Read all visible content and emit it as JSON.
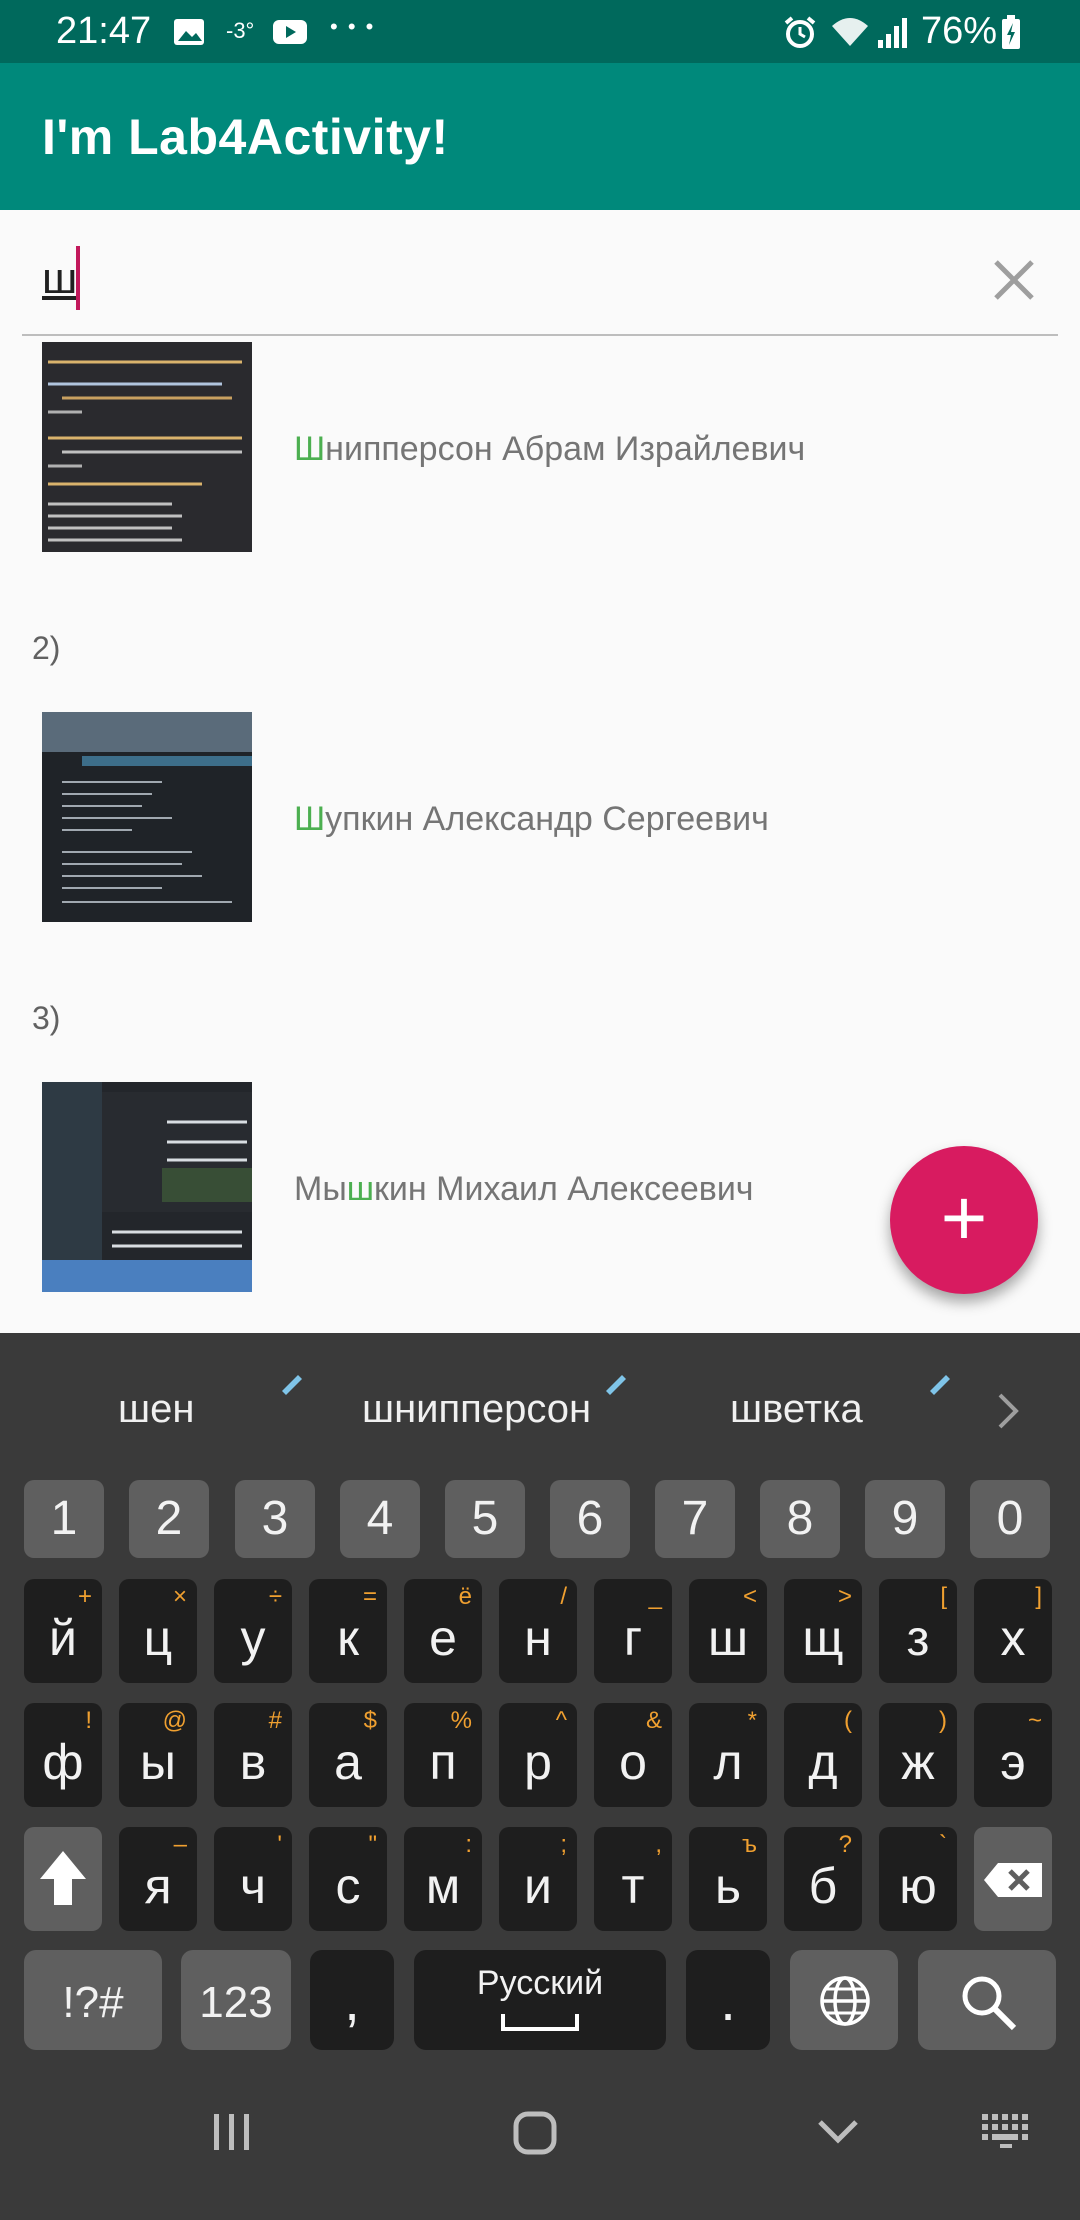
{
  "status_bar": {
    "time": "21:47",
    "temperature": "-3°",
    "more": "• • •",
    "battery": "76%",
    "icons": [
      "image-icon",
      "youtube-icon",
      "alarm-icon",
      "wifi-icon",
      "signal-icon",
      "battery-icon"
    ]
  },
  "app_bar": {
    "title": "I'm Lab4Activity!"
  },
  "search": {
    "value": "ш"
  },
  "list": [
    {
      "number": "",
      "highlight": "Ш",
      "rest": "нипперсон Абрам Израйлевич"
    },
    {
      "number": "2)",
      "highlight": "Ш",
      "rest": "упкин Александр Сергеевич"
    },
    {
      "number": "3)",
      "prefix": "Мы",
      "highlight": "ш",
      "rest": "кин Михаил Алексеевич"
    }
  ],
  "fab": {
    "label": "+"
  },
  "keyboard": {
    "suggestions": [
      "шен",
      "шнипперсон",
      "шветка"
    ],
    "numbers": [
      "1",
      "2",
      "3",
      "4",
      "5",
      "6",
      "7",
      "8",
      "9",
      "0"
    ],
    "row1": [
      {
        "k": "й",
        "h": "+"
      },
      {
        "k": "ц",
        "h": "×"
      },
      {
        "k": "у",
        "h": "÷"
      },
      {
        "k": "к",
        "h": "="
      },
      {
        "k": "е",
        "h": "ё"
      },
      {
        "k": "н",
        "h": "/"
      },
      {
        "k": "г",
        "h": "_"
      },
      {
        "k": "ш",
        "h": "<"
      },
      {
        "k": "щ",
        "h": ">"
      },
      {
        "k": "з",
        "h": "["
      },
      {
        "k": "х",
        "h": "]"
      }
    ],
    "row2": [
      {
        "k": "ф",
        "h": "!"
      },
      {
        "k": "ы",
        "h": "@"
      },
      {
        "k": "в",
        "h": "#"
      },
      {
        "k": "а",
        "h": "$"
      },
      {
        "k": "п",
        "h": "%"
      },
      {
        "k": "р",
        "h": "^"
      },
      {
        "k": "о",
        "h": "&"
      },
      {
        "k": "л",
        "h": "*"
      },
      {
        "k": "д",
        "h": "("
      },
      {
        "k": "ж",
        "h": ")"
      },
      {
        "k": "э",
        "h": "~"
      }
    ],
    "row3": [
      {
        "k": "я",
        "h": "–"
      },
      {
        "k": "ч",
        "h": "'"
      },
      {
        "k": "с",
        "h": "\""
      },
      {
        "k": "м",
        "h": ":"
      },
      {
        "k": "и",
        "h": ";"
      },
      {
        "k": "т",
        "h": ","
      },
      {
        "k": "ь",
        "h": "ъ"
      },
      {
        "k": "б",
        "h": "?"
      },
      {
        "k": "ю",
        "h": "`"
      }
    ],
    "symbols_label": "!?#",
    "numbers_label": "123",
    "comma": ",",
    "space_label": "Русский",
    "period": "."
  },
  "colors": {
    "accent": "#d81b60",
    "primary": "#00897b",
    "primary_dark": "#00695c",
    "highlight": "#4caf50"
  }
}
